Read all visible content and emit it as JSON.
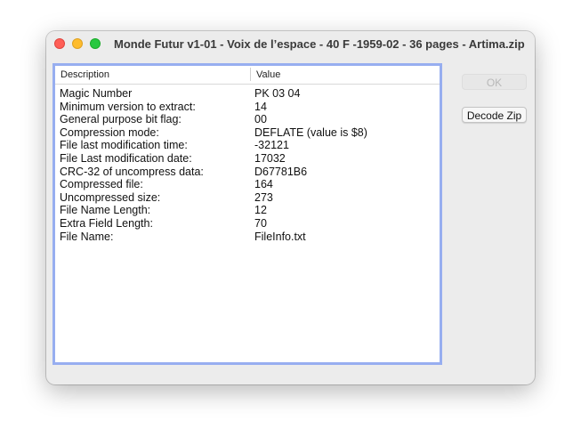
{
  "window": {
    "title": "Monde Futur v1-01 - Voix de l’espace - 40 F -1959-02 - 36 pages - Artima.zip"
  },
  "table": {
    "headers": {
      "description": "Description",
      "value": "Value"
    },
    "rows": [
      {
        "description": "Magic Number",
        "value": "PK 03 04"
      },
      {
        "description": "Minimum version to extract:",
        "value": "14"
      },
      {
        "description": "General purpose bit flag:",
        "value": "00"
      },
      {
        "description": "Compression mode:",
        "value": "DEFLATE (value is $8)"
      },
      {
        "description": "File last modification time:",
        "value": "-32121"
      },
      {
        "description": "File Last modification date:",
        "value": "17032"
      },
      {
        "description": "CRC-32 of uncompress data:",
        "value": "D67781B6"
      },
      {
        "description": "Compressed file:",
        "value": "164"
      },
      {
        "description": "Uncompressed size:",
        "value": "273"
      },
      {
        "description": "File Name Length:",
        "value": "12"
      },
      {
        "description": "Extra Field Length:",
        "value": "70"
      },
      {
        "description": "File Name:",
        "value": "FileInfo.txt"
      }
    ]
  },
  "buttons": {
    "ok_label": "OK",
    "decode_label": "Decode Zip"
  }
}
